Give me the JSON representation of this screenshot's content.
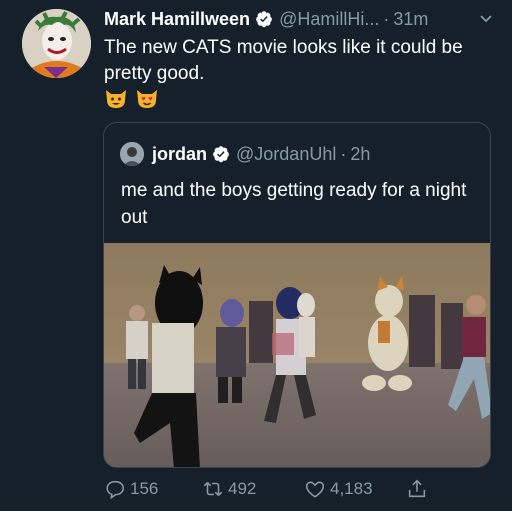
{
  "tweet": {
    "author_name": "Mark Hamillween",
    "handle": "@HamillHi...",
    "separator": "·",
    "time": "31m",
    "text": "The new CATS movie looks like it could be pretty good.",
    "emojis": [
      "smiley-cat-emoji",
      "heart-eyes-cat-emoji"
    ]
  },
  "quoted_tweet": {
    "author_name": "jordan",
    "handle": "@JordanUhl",
    "separator": "·",
    "time": "2h",
    "text": "me and the boys getting ready for a night out"
  },
  "actions": {
    "reply_count": "156",
    "retweet_count": "492",
    "like_count": "4,183"
  },
  "colors": {
    "background": "#15202b",
    "secondary_text": "#8899a6",
    "border": "#38444d",
    "verified_badge": "#ffffff"
  },
  "icons": [
    "chevron-down-icon",
    "verified-icon",
    "reply-icon",
    "retweet-icon",
    "like-icon",
    "share-icon"
  ]
}
